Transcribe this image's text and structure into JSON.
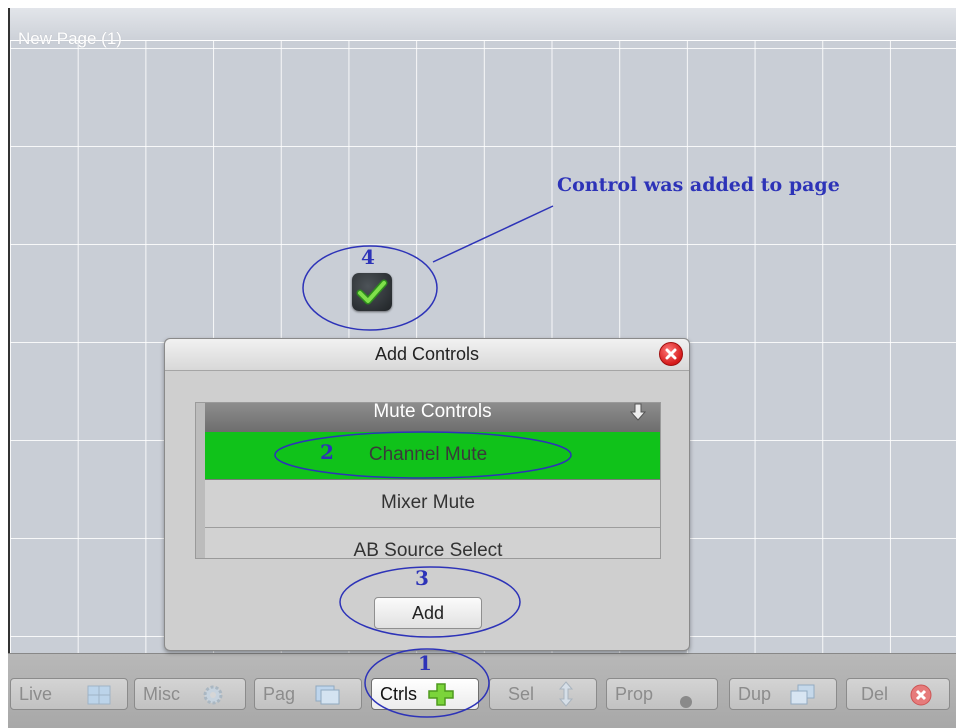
{
  "page": {
    "title": "New Page (1)"
  },
  "annotations": {
    "label": "Control was added to page",
    "step1": "1",
    "step2": "2",
    "step3": "3",
    "step4": "4"
  },
  "dialog": {
    "title": "Add Controls",
    "list_header": "Mute Controls",
    "items": [
      {
        "label": "Channel Mute",
        "selected": true
      },
      {
        "label": "Mixer Mute",
        "selected": false
      },
      {
        "label": "AB Source Select",
        "selected": false
      }
    ],
    "add_label": "Add"
  },
  "toolbar": {
    "buttons": [
      {
        "label": "Live",
        "icon": "grid-icon"
      },
      {
        "label": "Misc",
        "icon": "gear-icon"
      },
      {
        "label": "Pag",
        "icon": "window-icon"
      },
      {
        "label": "Ctrls",
        "icon": "plus-icon",
        "active": true
      },
      {
        "label": "Sel",
        "icon": "up-down-arrow-icon"
      },
      {
        "label": "Prop",
        "icon": "dot-icon"
      },
      {
        "label": "Dup",
        "icon": "duplicate-icon"
      },
      {
        "label": "Del",
        "icon": "close-icon"
      }
    ]
  },
  "colors": {
    "annotation": "#2d33b8",
    "selected_row": "#10c21a",
    "canvas": "#c9ced6"
  }
}
